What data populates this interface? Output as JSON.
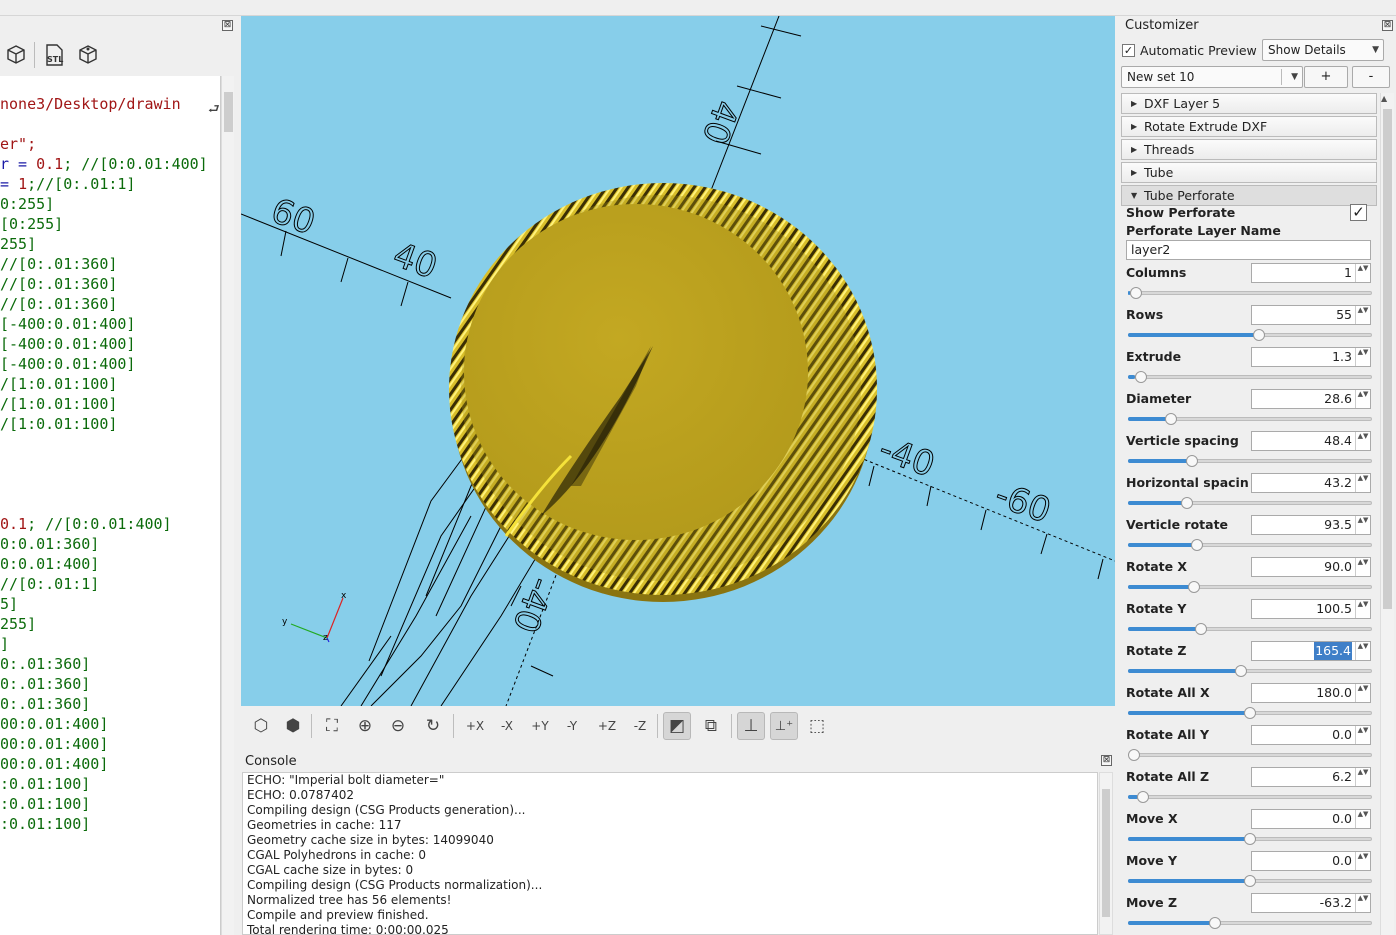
{
  "editor": {
    "close_glyph": "⊠",
    "toolbar": [
      "export-3d-icon",
      "export-stl-icon",
      "export-3mf-icon"
    ],
    "stl_label": "STL",
    "lines": [
      {
        "parts": [
          {
            "t": "none3/Desktop/drawin",
            "c": "c-path"
          }
        ]
      },
      {
        "parts": [
          {
            "t": "",
            "c": ""
          }
        ]
      },
      {
        "parts": [
          {
            "t": "er\";",
            "c": "c-str"
          }
        ]
      },
      {
        "parts": [
          {
            "t": "r = ",
            "c": "c-blu"
          },
          {
            "t": "0.1",
            "c": "c-str"
          },
          {
            "t": "; //[0:0.01:400]",
            "c": "c-grn"
          }
        ]
      },
      {
        "parts": [
          {
            "t": "= ",
            "c": "c-blu"
          },
          {
            "t": "1",
            "c": "c-str"
          },
          {
            "t": ";//[0:.01:1]",
            "c": "c-grn"
          }
        ]
      },
      {
        "parts": [
          {
            "t": "0:255]",
            "c": "c-grn"
          }
        ]
      },
      {
        "parts": [
          {
            "t": "[0:255]",
            "c": "c-grn"
          }
        ]
      },
      {
        "parts": [
          {
            "t": "255]",
            "c": "c-grn"
          }
        ]
      },
      {
        "parts": [
          {
            "t": "//[0:.01:360]",
            "c": "c-grn"
          }
        ]
      },
      {
        "parts": [
          {
            "t": "//[0:.01:360]",
            "c": "c-grn"
          }
        ]
      },
      {
        "parts": [
          {
            "t": "//[0:.01:360]",
            "c": "c-grn"
          }
        ]
      },
      {
        "parts": [
          {
            "t": "[-400:0.01:400]",
            "c": "c-grn"
          }
        ]
      },
      {
        "parts": [
          {
            "t": "[-400:0.01:400]",
            "c": "c-grn"
          }
        ]
      },
      {
        "parts": [
          {
            "t": "[-400:0.01:400]",
            "c": "c-grn"
          }
        ]
      },
      {
        "parts": [
          {
            "t": "/[1:0.01:100]",
            "c": "c-grn"
          }
        ]
      },
      {
        "parts": [
          {
            "t": "/[1:0.01:100]",
            "c": "c-grn"
          }
        ]
      },
      {
        "parts": [
          {
            "t": "/[1:0.01:100]",
            "c": "c-grn"
          }
        ]
      },
      {
        "parts": [
          {
            "t": "",
            "c": ""
          }
        ]
      },
      {
        "parts": [
          {
            "t": "",
            "c": ""
          }
        ]
      },
      {
        "parts": [
          {
            "t": "",
            "c": ""
          }
        ]
      },
      {
        "parts": [
          {
            "t": "",
            "c": ""
          }
        ]
      },
      {
        "parts": [
          {
            "t": "0.1",
            "c": "c-str"
          },
          {
            "t": "; //[0:0.01:400]",
            "c": "c-grn"
          }
        ]
      },
      {
        "parts": [
          {
            "t": "0:0.01:360]",
            "c": "c-grn"
          }
        ]
      },
      {
        "parts": [
          {
            "t": "0:0.01:400]",
            "c": "c-grn"
          }
        ]
      },
      {
        "parts": [
          {
            "t": "//[0:.01:1]",
            "c": "c-grn"
          }
        ]
      },
      {
        "parts": [
          {
            "t": "5]",
            "c": "c-grn"
          }
        ]
      },
      {
        "parts": [
          {
            "t": "255]",
            "c": "c-grn"
          }
        ]
      },
      {
        "parts": [
          {
            "t": "]",
            "c": "c-grn"
          }
        ]
      },
      {
        "parts": [
          {
            "t": "0:.01:360]",
            "c": "c-grn"
          }
        ]
      },
      {
        "parts": [
          {
            "t": "0:.01:360]",
            "c": "c-grn"
          }
        ]
      },
      {
        "parts": [
          {
            "t": "0:.01:360]",
            "c": "c-grn"
          }
        ]
      },
      {
        "parts": [
          {
            "t": "00:0.01:400]",
            "c": "c-grn"
          }
        ]
      },
      {
        "parts": [
          {
            "t": "00:0.01:400]",
            "c": "c-grn"
          }
        ]
      },
      {
        "parts": [
          {
            "t": "00:0.01:400]",
            "c": "c-grn"
          }
        ]
      },
      {
        "parts": [
          {
            "t": ":0.01:100]",
            "c": "c-grn"
          }
        ]
      },
      {
        "parts": [
          {
            "t": ":0.01:100]",
            "c": "c-grn"
          }
        ]
      },
      {
        "parts": [
          {
            "t": ":0.01:100]",
            "c": "c-grn"
          }
        ]
      }
    ]
  },
  "viewport": {
    "background": "#87ceea",
    "object_color": "#c0a822",
    "highlight_color": "#f5e23a",
    "axis_labels": [
      "60",
      "40",
      "40",
      "-40",
      "-60",
      "-40"
    ],
    "gizmo": {
      "x": "x",
      "y": "y",
      "z": "z"
    }
  },
  "view_toolbar": {
    "buttons": [
      "preview",
      "render",
      "view-all",
      "zoom-in",
      "zoom-out",
      "reset-view",
      "view-right",
      "view-left",
      "view-top",
      "view-bottom",
      "view-front",
      "view-back",
      "perspective",
      "orthogonal",
      "show-axes",
      "show-scale-markers",
      "show-edges"
    ],
    "active": [
      "perspective",
      "show-axes",
      "show-scale-markers"
    ]
  },
  "console": {
    "title": "Console",
    "close_glyph": "⊠",
    "lines": [
      "ECHO: \"Imperial bolt diameter=\"",
      "ECHO: 0.0787402",
      "Compiling design (CSG Products generation)...",
      "Geometries in cache: 117",
      "Geometry cache size in bytes: 14099040",
      "CGAL Polyhedrons in cache: 0",
      "CGAL cache size in bytes: 0",
      "Compiling design (CSG Products normalization)...",
      "Normalized tree has 56 elements!",
      "Compile and preview finished.",
      "Total rendering time: 0:00:00.025"
    ]
  },
  "customizer": {
    "title": "Customizer",
    "close_glyph": "⊠",
    "auto_preview_label": "Automatic Preview",
    "auto_preview_checked": true,
    "details_select": "Show Details",
    "preset_select": "New set 10",
    "add_label": "+",
    "remove_label": "-",
    "groups": [
      {
        "label": "DXF Layer 5",
        "open": false
      },
      {
        "label": "Rotate Extrude DXF",
        "open": false
      },
      {
        "label": "Threads",
        "open": false
      },
      {
        "label": "Tube",
        "open": false
      },
      {
        "label": "Tube Perforate",
        "open": true
      }
    ],
    "show_perforate_label": "Show Perforate",
    "show_perforate_checked": true,
    "layer_name_label": "Perforate Layer Name",
    "layer_name_value": "layer2",
    "params": [
      {
        "label": "Columns",
        "value": "1",
        "level": 0.01
      },
      {
        "label": "Rows",
        "value": "55",
        "level": 0.54
      },
      {
        "label": "Extrude",
        "value": "1.3",
        "level": 0.03
      },
      {
        "label": "Diameter",
        "value": "28.6",
        "level": 0.16
      },
      {
        "label": "Verticle spacing",
        "value": "48.4",
        "level": 0.25
      },
      {
        "label": "Horizontal spacing",
        "value": "43.2",
        "level": 0.23
      },
      {
        "label": "Verticle rotate",
        "value": "93.5",
        "level": 0.27
      },
      {
        "label": "Rotate X",
        "value": "90.0",
        "level": 0.26
      },
      {
        "label": "Rotate Y",
        "value": "100.5",
        "level": 0.29
      },
      {
        "label": "Rotate Z",
        "value": "165.4",
        "level": 0.46,
        "selected": true
      },
      {
        "label": "Rotate All X",
        "value": "180.0",
        "level": 0.5
      },
      {
        "label": "Rotate All Y",
        "value": "0.0",
        "level": 0.0
      },
      {
        "label": "Rotate All Z",
        "value": "6.2",
        "level": 0.04
      },
      {
        "label": "Move X",
        "value": "0.0",
        "level": 0.5
      },
      {
        "label": "Move Y",
        "value": "0.0",
        "level": 0.5
      },
      {
        "label": "Move Z",
        "value": "-63.2",
        "level": 0.35
      }
    ]
  }
}
